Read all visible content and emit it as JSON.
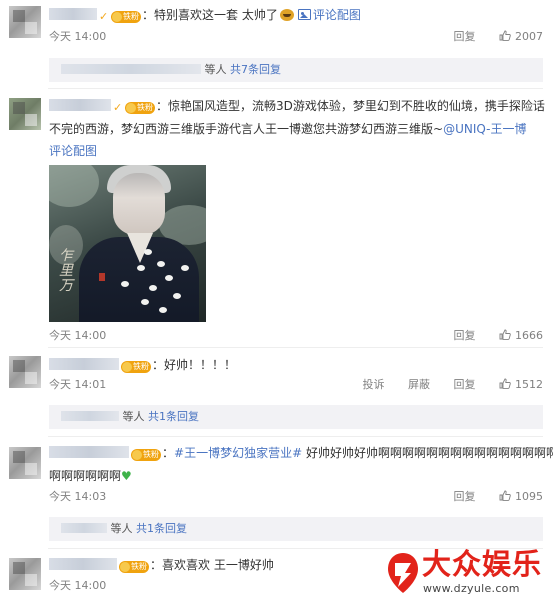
{
  "comments": [
    {
      "text_before": "：特别喜欢这一套 太帅了",
      "img_label": "评论配图",
      "time": "今天 14:00",
      "reply_label": "回复",
      "likes": "2007",
      "emoji": "laughing-emoji",
      "replies_summary": {
        "prefix": "等人",
        "count_text": "共7条回复"
      }
    },
    {
      "line1": "：惊艳国风造型，流畅3D游戏体验，梦里幻到不胜收的仙境，携手探险话",
      "line2_text": "不完的西游，梦幻西游三维版手游代言人王一博邀您共游梦幻西游三维版~",
      "line2_link": "@UNIQ-王一博",
      "img_label": "评论配图",
      "time": "今天 14:00",
      "reply_label": "回复",
      "likes": "1666"
    },
    {
      "text": "：好帅！！！！",
      "time": "今天 14:01",
      "report_label": "投诉",
      "block_label": "屏蔽",
      "reply_label": "回复",
      "likes": "1512",
      "replies_summary": {
        "prefix": "等人",
        "count_text": "共1条回复"
      }
    },
    {
      "link": "#王一博梦幻独家营业#",
      "text_after": " 好帅好帅好帅啊啊啊啊啊啊啊啊啊啊啊啊啊啊啊啊",
      "line2": "啊啊啊啊啊啊",
      "time": "今天 14:03",
      "reply_label": "回复",
      "likes": "1095",
      "replies_summary": {
        "prefix": "等人",
        "count_text": "共1条回复"
      }
    },
    {
      "text": "：喜欢喜欢 王一博好帅",
      "time": "今天 14:00"
    }
  ],
  "watermark": {
    "brand": "大众娱乐",
    "url": "www.dzyule.com"
  },
  "colors": {
    "link": "#4a74c1",
    "meta_gray": "#808080",
    "reply_box_bg": "#f2f2f5",
    "watermark_red": "#e2231a",
    "badge_orange": "#f0a30f"
  }
}
